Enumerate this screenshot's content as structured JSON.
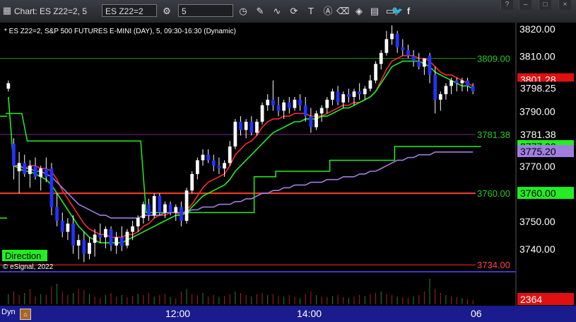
{
  "toolbar": {
    "title": "Chart: ES Z22=2, 5",
    "symbol": "ES Z22=2",
    "interval": "5",
    "icons": [
      "gear-icon",
      "clock-icon",
      "pencil-icon",
      "curve-icon",
      "circle-arrow-icon",
      "T-icon",
      "A-icon",
      "eraser-icon",
      "layers-icon",
      "grid-icon",
      "chat-icon",
      "twitter-icon",
      "facebook-icon"
    ],
    "window_buttons": [
      "?",
      "–",
      "□",
      "×"
    ]
  },
  "chart_data": {
    "type": "candlestick",
    "title": "* ES Z22=2, S&P 500 FUTURES E-MINI (DAY), 5, 09:30-16:30 (Dynamic)",
    "watermark": "© eSignal, 2022",
    "study_label": "Direction",
    "ylim": [
      3732,
      3822
    ],
    "y_ticks": [
      "3820.00",
      "3810.00",
      "3790.00",
      "3770.00",
      "3750.00",
      "3740.00"
    ],
    "x_ticks": [
      "12:00",
      "14:00",
      "06"
    ],
    "candles": [
      [
        3798,
        3801,
        3797,
        3800
      ],
      [
        3778,
        3780,
        3765,
        3770
      ],
      [
        3768,
        3775,
        3760,
        3771
      ],
      [
        3771,
        3774,
        3766,
        3767
      ],
      [
        3767,
        3772,
        3762,
        3770
      ],
      [
        3770,
        3773,
        3765,
        3766
      ],
      [
        3766,
        3770,
        3761,
        3769
      ],
      [
        3769,
        3773,
        3764,
        3766
      ],
      [
        3769,
        3771,
        3752,
        3755
      ],
      [
        3755,
        3760,
        3748,
        3750
      ],
      [
        3750,
        3753,
        3744,
        3746
      ],
      [
        3746,
        3751,
        3743,
        3749
      ],
      [
        3749,
        3752,
        3738,
        3741
      ],
      [
        3741,
        3745,
        3736,
        3743
      ],
      [
        3743,
        3746,
        3735,
        3738
      ],
      [
        3738,
        3744,
        3736,
        3742
      ],
      [
        3742,
        3747,
        3737,
        3745
      ],
      [
        3745,
        3749,
        3742,
        3744
      ],
      [
        3744,
        3748,
        3740,
        3747
      ],
      [
        3747,
        3748,
        3739,
        3741
      ],
      [
        3741,
        3746,
        3738,
        3744
      ],
      [
        3744,
        3748,
        3739,
        3741
      ],
      [
        3741,
        3747,
        3740,
        3746
      ],
      [
        3746,
        3750,
        3743,
        3748
      ],
      [
        3748,
        3752,
        3746,
        3751
      ],
      [
        3751,
        3757,
        3749,
        3756
      ],
      [
        3756,
        3758,
        3750,
        3752
      ],
      [
        3752,
        3760,
        3751,
        3759
      ],
      [
        3759,
        3760,
        3752,
        3753
      ],
      [
        3753,
        3757,
        3751,
        3756
      ],
      [
        3756,
        3757,
        3752,
        3753
      ],
      [
        3753,
        3756,
        3750,
        3755
      ],
      [
        3755,
        3757,
        3748,
        3750
      ],
      [
        3750,
        3762,
        3749,
        3761
      ],
      [
        3761,
        3768,
        3760,
        3767
      ],
      [
        3767,
        3773,
        3765,
        3772
      ],
      [
        3772,
        3776,
        3770,
        3774
      ],
      [
        3774,
        3776,
        3771,
        3772
      ],
      [
        3772,
        3774,
        3768,
        3770
      ],
      [
        3770,
        3773,
        3767,
        3769
      ],
      [
        3769,
        3772,
        3766,
        3771
      ],
      [
        3771,
        3779,
        3770,
        3777
      ],
      [
        3777,
        3787,
        3776,
        3786
      ],
      [
        3786,
        3788,
        3781,
        3783
      ],
      [
        3783,
        3787,
        3780,
        3786
      ],
      [
        3786,
        3788,
        3781,
        3782
      ],
      [
        3782,
        3787,
        3781,
        3786
      ],
      [
        3786,
        3793,
        3785,
        3792
      ],
      [
        3792,
        3796,
        3790,
        3794
      ],
      [
        3794,
        3801,
        3790,
        3792
      ],
      [
        3792,
        3795,
        3788,
        3790
      ],
      [
        3790,
        3794,
        3787,
        3793
      ],
      [
        3793,
        3795,
        3789,
        3791
      ],
      [
        3791,
        3795,
        3790,
        3794
      ],
      [
        3794,
        3796,
        3790,
        3792
      ],
      [
        3792,
        3795,
        3786,
        3788
      ],
      [
        3788,
        3791,
        3782,
        3784
      ],
      [
        3784,
        3790,
        3783,
        3789
      ],
      [
        3789,
        3792,
        3786,
        3791
      ],
      [
        3791,
        3795,
        3789,
        3794
      ],
      [
        3794,
        3798,
        3792,
        3797
      ],
      [
        3797,
        3799,
        3792,
        3793
      ],
      [
        3793,
        3797,
        3791,
        3796
      ],
      [
        3796,
        3798,
        3793,
        3795
      ],
      [
        3795,
        3798,
        3792,
        3797
      ],
      [
        3797,
        3800,
        3794,
        3796
      ],
      [
        3796,
        3799,
        3794,
        3798
      ],
      [
        3798,
        3803,
        3797,
        3801
      ],
      [
        3801,
        3808,
        3800,
        3807
      ],
      [
        3807,
        3812,
        3805,
        3811
      ],
      [
        3811,
        3819,
        3810,
        3816
      ],
      [
        3816,
        3821,
        3814,
        3818
      ],
      [
        3818,
        3819,
        3811,
        3813
      ],
      [
        3813,
        3816,
        3810,
        3812
      ],
      [
        3812,
        3814,
        3809,
        3810
      ],
      [
        3810,
        3812,
        3806,
        3808
      ],
      [
        3808,
        3811,
        3805,
        3806
      ],
      [
        3806,
        3809,
        3803,
        3809
      ],
      [
        3810,
        3811,
        3800,
        3803
      ],
      [
        3803,
        3806,
        3789,
        3794
      ],
      [
        3794,
        3797,
        3790,
        3796
      ],
      [
        3796,
        3800,
        3794,
        3799
      ],
      [
        3799,
        3802,
        3796,
        3801
      ],
      [
        3801,
        3802,
        3797,
        3800
      ],
      [
        3800,
        3802,
        3797,
        3801
      ],
      [
        3801,
        3802,
        3797,
        3799
      ],
      [
        3799,
        3800,
        3796,
        3797
      ]
    ],
    "moving_averages": [
      {
        "name": "ema_fast",
        "color": "#ff2a2a",
        "values": [
          null,
          3770,
          3770,
          3769,
          3770,
          3770,
          3769,
          3769,
          3768,
          3765,
          3761,
          3758,
          3755,
          3752,
          3749,
          3747,
          3746,
          3745,
          3745,
          3744,
          3744,
          3744,
          3745,
          3745,
          3746,
          3748,
          3749,
          3751,
          3752,
          3752,
          3753,
          3753,
          3752,
          3754,
          3756,
          3759,
          3762,
          3764,
          3765,
          3766,
          3767,
          3770,
          3774,
          3776,
          3778,
          3779,
          3781,
          3784,
          3786,
          3787,
          3787,
          3788,
          3788,
          3789,
          3789,
          3789,
          3788,
          3788,
          3788,
          3789,
          3790,
          3791,
          3792,
          3792,
          3793,
          3793,
          3794,
          3795,
          3797,
          3801,
          3805,
          3808,
          3809,
          3810,
          3810,
          3810,
          3809,
          3809,
          3808,
          3806,
          3804,
          3803,
          3803,
          3802,
          3801,
          3800,
          3799
        ]
      },
      {
        "name": "ema_slow",
        "color": "#22ee22",
        "values": [
          3795,
          3770,
          3769,
          3768,
          3768,
          3767,
          3766,
          3765,
          3763,
          3760,
          3757,
          3754,
          3751,
          3748,
          3746,
          3744,
          3743,
          3742,
          3742,
          3742,
          3742,
          3742,
          3743,
          3744,
          3745,
          3746,
          3747,
          3748,
          3749,
          3750,
          3751,
          3752,
          3752,
          3753,
          3755,
          3757,
          3759,
          3760,
          3761,
          3762,
          3763,
          3765,
          3768,
          3770,
          3772,
          3774,
          3776,
          3778,
          3780,
          3782,
          3783,
          3784,
          3785,
          3786,
          3786,
          3787,
          3787,
          3787,
          3788,
          3788,
          3789,
          3790,
          3791,
          3791,
          3792,
          3793,
          3794,
          3795,
          3797,
          3800,
          3803,
          3806,
          3807,
          3808,
          3808,
          3808,
          3808,
          3807,
          3806,
          3804,
          3803,
          3802,
          3801,
          3800,
          3799,
          3799,
          3798
        ]
      },
      {
        "name": "vwap",
        "color": "#a07ee0",
        "values": [
          null,
          3770,
          3770,
          3769,
          3769,
          3768,
          3768,
          3767,
          3766,
          3764,
          3762,
          3760,
          3758,
          3756,
          3755,
          3754,
          3753,
          3752,
          3752,
          3751,
          3751,
          3751,
          3751,
          3751,
          3751,
          3752,
          3752,
          3752,
          3752,
          3753,
          3753,
          3753,
          3753,
          3753,
          3754,
          3754,
          3755,
          3755,
          3755,
          3756,
          3756,
          3756,
          3757,
          3757,
          3758,
          3758,
          3759,
          3760,
          3760,
          3761,
          3761,
          3762,
          3762,
          3763,
          3763,
          3763,
          3764,
          3764,
          3764,
          3765,
          3765,
          3765,
          3766,
          3766,
          3766,
          3767,
          3767,
          3768,
          3768,
          3769,
          3770,
          3771,
          3772,
          3772,
          3773,
          3773,
          3774,
          3774,
          3774,
          3775,
          3775,
          3775,
          3775,
          3775,
          3775,
          3775,
          3775
        ]
      }
    ],
    "step_line": {
      "name": "trend_step",
      "color": "#22ee22",
      "segments": [
        [
          0,
          3789,
          2
        ],
        [
          4,
          3779,
          24
        ],
        [
          26,
          3753,
          45
        ],
        [
          46,
          3766,
          49
        ],
        [
          50,
          3768,
          59
        ],
        [
          60,
          3772,
          71
        ],
        [
          72,
          3777,
          87
        ]
      ]
    },
    "horizontal_lines": [
      {
        "value": 3809.0,
        "color": "#1e8c1e",
        "label": "3809.00"
      },
      {
        "value": 3781.38,
        "color": "#7a2a8c",
        "label": "3781.38"
      },
      {
        "value": 3760.0,
        "color": "#22ee22",
        "label": "3760.00"
      },
      {
        "value": 3760.0,
        "color": "#ff2a2a",
        "label": ""
      },
      {
        "value": 3734.0,
        "color": "#ff2a2a",
        "label": "3734.00"
      }
    ],
    "price_flags": [
      {
        "value": 3801.28,
        "bg": "#e01010",
        "fg": "#ffffff",
        "label": "3801.28"
      },
      {
        "value": 3798.25,
        "bg": "#000000",
        "fg": "#ffffff",
        "label": "3798.25"
      },
      {
        "value": 3781.38,
        "bg": "#000000",
        "fg": "#ffffff",
        "label": "3781.38"
      },
      {
        "value": 3777.0,
        "bg": "#22ee22",
        "fg": "#000000",
        "label": "3777.00"
      },
      {
        "value": 3775.2,
        "bg": "#a07ee0",
        "fg": "#000000",
        "label": "3775.20"
      },
      {
        "value": 3760.0,
        "bg": "#22ee22",
        "fg": "#000000",
        "label": "3760.00"
      }
    ],
    "volume": {
      "label": "2364",
      "values": [
        20,
        25,
        18,
        22,
        30,
        15,
        20,
        18,
        35,
        40,
        25,
        18,
        22,
        30,
        28,
        20,
        15,
        12,
        18,
        22,
        15,
        18,
        14,
        16,
        20,
        18,
        22,
        15,
        18,
        20,
        14,
        12,
        25,
        30,
        20,
        18,
        22,
        15,
        18,
        14,
        16,
        20,
        25,
        22,
        18,
        15,
        20,
        22,
        18,
        20,
        16,
        15,
        18,
        14,
        12,
        20,
        25,
        18,
        15,
        14,
        16,
        18,
        14,
        12,
        15,
        18,
        16,
        20,
        22,
        25,
        20,
        18,
        15,
        14,
        12,
        16,
        18,
        25,
        50,
        30,
        22,
        18,
        15,
        14,
        12,
        10,
        8
      ],
      "max": 55
    },
    "colors": {
      "up": "#ffffff",
      "down": "#2233ff",
      "background": "#000000",
      "grid_divider": "#3b3bbf",
      "direction_bg": "#22ee22"
    }
  },
  "footer": {
    "label": "Dyn",
    "x_ticks": [
      "12:00",
      "14:00",
      "06"
    ]
  }
}
